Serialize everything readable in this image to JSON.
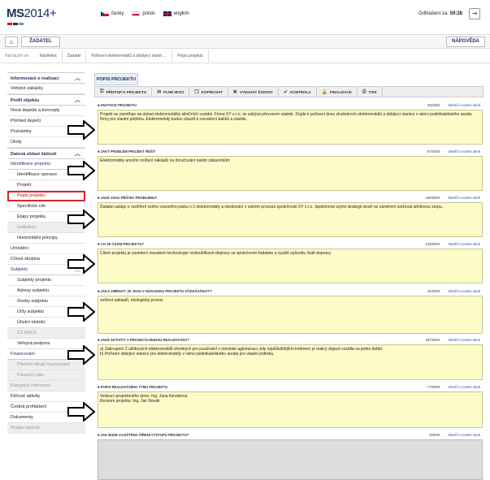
{
  "header": {
    "logo_main": "MS",
    "logo_year": "2014+",
    "logo_colors": [
      "#d7141a",
      "#1f2f5e",
      "#7f8fb6"
    ],
    "languages": [
      {
        "label": "česky",
        "flag": "cz"
      },
      {
        "label": "polski",
        "flag": "pl"
      },
      {
        "label": "english",
        "flag": "en"
      }
    ],
    "logout_label": "Odhlášení za:",
    "logout_timer": "59:28",
    "logout_icon": "logout-icon"
  },
  "navbar": {
    "home_icon": "home-icon",
    "zadatel": "ŽADATEL",
    "napoveda": "NÁPOVĚDA"
  },
  "breadcrumb": {
    "label": "Nacházíte se:",
    "items": [
      "Nástěnka",
      "Žadatel",
      "Pořízení elektromobilů a dobíjecí stanic ...",
      "Popis projektu"
    ]
  },
  "sidebar": {
    "items": [
      {
        "label": "Informování o realizaci",
        "type": "head",
        "chev": "︿"
      },
      {
        "label": "Veřejné zakázky",
        "type": "item"
      },
      {
        "label": "Profil objektu",
        "type": "head",
        "chev": "︿"
      },
      {
        "label": "Nová depeše a koncepty",
        "type": "item"
      },
      {
        "label": "Přehled depeší",
        "type": "item"
      },
      {
        "label": "Poznámky",
        "type": "item"
      },
      {
        "label": "Úkoly",
        "type": "item"
      },
      {
        "label": "Datová oblast žádosti",
        "type": "head",
        "chev": "︿"
      },
      {
        "label": "Identifikace projektu",
        "type": "subhead"
      },
      {
        "label": "Identifikace operace",
        "type": "sub"
      },
      {
        "label": "Projekt",
        "type": "sub"
      },
      {
        "label": "Popis projektu",
        "type": "sel"
      },
      {
        "label": "Specifické cíle",
        "type": "sub"
      },
      {
        "label": "Etapy projektu",
        "type": "sub"
      },
      {
        "label": "Indikátory",
        "type": "dis"
      },
      {
        "label": "Horizontální principy",
        "type": "sub"
      },
      {
        "label": "Umístění",
        "type": "item"
      },
      {
        "label": "Cílová skupina",
        "type": "item"
      },
      {
        "label": "Subjekty",
        "type": "subhead",
        "chev": "︿"
      },
      {
        "label": "Subjekty projektu",
        "type": "sub"
      },
      {
        "label": "Adresy subjektu",
        "type": "sub"
      },
      {
        "label": "Osoby subjektu",
        "type": "sub"
      },
      {
        "label": "Účty subjektu",
        "type": "sub"
      },
      {
        "label": "Účetní období",
        "type": "sub"
      },
      {
        "label": "CZ NACE",
        "type": "dis"
      },
      {
        "label": "Veřejná podpora",
        "type": "sub"
      },
      {
        "label": "Financování",
        "type": "subhead"
      },
      {
        "label": "Přehled zdrojů financování",
        "type": "dis"
      },
      {
        "label": "Finanční plán",
        "type": "dis"
      },
      {
        "label": "Kategorie intervencí",
        "type": "grey"
      },
      {
        "label": "Klíčové aktivity",
        "type": "item"
      },
      {
        "label": "Čestná prohlášení",
        "type": "item"
      },
      {
        "label": "Dokumenty",
        "type": "item"
      },
      {
        "label": "Podpis žádosti",
        "type": "grey"
      }
    ]
  },
  "main": {
    "tab": "POPIS PROJEKTU",
    "toolbar": [
      {
        "label": "PŘÍSTUP K PROJEKTU",
        "icon": "key-icon"
      },
      {
        "label": "PLNÉ MOCI",
        "icon": "envelope-icon"
      },
      {
        "label": "KOPÍROVAT",
        "icon": "copy-icon"
      },
      {
        "label": "VYMAZAT ŽÁDOST",
        "icon": "close-icon"
      },
      {
        "label": "KONTROLA",
        "icon": "check-icon"
      },
      {
        "label": "FINALIZACE",
        "icon": "lock-icon"
      },
      {
        "label": "TISK",
        "icon": "print-icon"
      }
    ],
    "open_label": "Otevřít v novém okně",
    "fields": [
      {
        "label": "ANOTACE PROJEKTU",
        "count": "292/300",
        "text": "Projekt se zaměřuje na oblast elektromobility silničních vozidel. Firma XY s.r.o. se zabývá převozem zásilek. Dojde k pořízení dvou zkušebních elektromobilů a dobíjecí stanice v rámci podnikatelského areálu firmy pro vlastní potřebu. Elektromobily budou sloužit k rozvážení balíků a zásilek."
      },
      {
        "label": "JAKÝ PROBLÉM PROJEKT ŘEŠÍ?",
        "count": "57/2000",
        "text": "Elektromobily umožní snížení nákladů na doručování našim zákazníkům"
      },
      {
        "label": "JAKÉ JSOU PŘÍČINY PROBLÉMU?",
        "count": "186/2000",
        "text": "Žadatel usiluje o rozšíření svého vozového parku o 2 elektromobily a otestování v ostrém provozu společnosti XY s.r.o. Společnost svými strategii stvaří se záměrem snižovat uhlíkovou stopu."
      },
      {
        "label": "CO JE CÍLEM PROJEKTU?",
        "count": "129/2000",
        "text": "Cílem projektu je zavedení inovativní technologie nízkouhlíkové dopravy ve společnosti žadatele a využití způsobu čisté dopravy."
      },
      {
        "label": "JAKÁ ZMĚNA/Y JE JSOU V DŮSLEDKU PROJEKTU OČEKÁVÁNA/Y?",
        "count": "34/2000",
        "text": "snížení nákladů, ekologický provoz"
      },
      {
        "label": "JAKÉ AKTIVITY V PROJEKTU BUDOU REALIZOVÁNY?",
        "count": "257/2000",
        "text": "a) Zakoupení 2 užitkových elektromobilů vhodných pro používání v městské aglomeraci, kdy nejdůležitějším kritériem je reálný dojezd vozidla na jedno dobití.\nb) Pořízení dobíjecí stanice pro elektromobily v rámci podnikatelského areálu pro vlastní potřebu."
      },
      {
        "label": "POPIS REALIZAČNÍHO TÝMU PROJEKTU",
        "count": "77/2000",
        "text": "Vedoucí projektového týmu: Ing. Jana Nováková\nEkonom projektu: Ing. Jan Novák"
      },
      {
        "label": "JAK BUDE ZAJIŠTĚNO ŠÍŘENÍ VÝSTUPŮ PROJEKTU?",
        "count": "0/2000",
        "text": ""
      }
    ]
  }
}
